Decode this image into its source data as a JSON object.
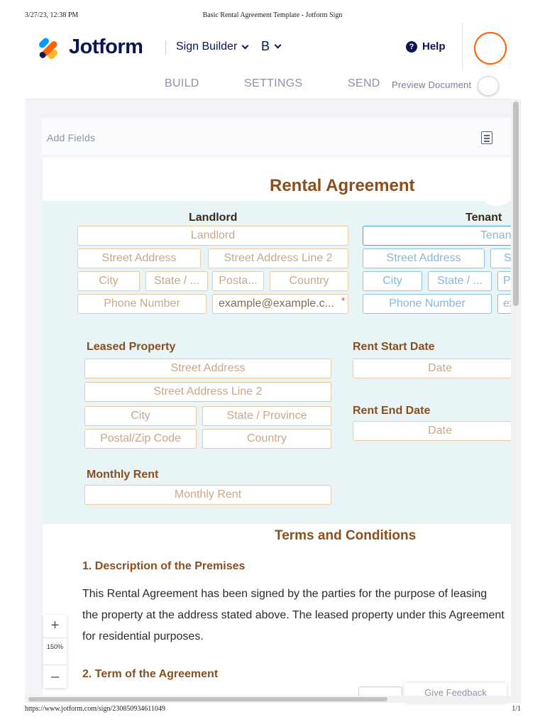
{
  "print": {
    "datetime": "3/27/23, 12:38 PM",
    "title": "Basic Rental Agreement Template - Jotform Sign",
    "url": "https://www.jotform.com/sign/230850934611049",
    "page": "1/1"
  },
  "header": {
    "logo_text": "Jotform",
    "sign_builder": "Sign Builder",
    "b_menu": "B",
    "help": "Help",
    "help_glyph": "?"
  },
  "tabs": {
    "build": "BUILD",
    "settings": "SETTINGS",
    "send": "SEND",
    "preview": "Preview Document"
  },
  "toolbar": {
    "add_fields": "Add Fields",
    "icon": "document-list-icon"
  },
  "document": {
    "title": "Rental Agreement",
    "landlord": {
      "heading": "Landlord",
      "name": "Landlord",
      "street": "Street Address",
      "street2": "Street Address Line 2",
      "city": "City",
      "state": "State / ...",
      "postal": "Posta...",
      "country": "Country",
      "phone": "Phone Number",
      "email": "example@example.c...",
      "required": "*"
    },
    "tenant": {
      "heading": "Tenant",
      "name": "Tenan",
      "street": "Street Address",
      "street2": "S",
      "city": "City",
      "state": "State / ...",
      "postal": "P",
      "phone": "Phone Number",
      "email": "ex"
    },
    "leased": {
      "heading": "Leased Property",
      "street": "Street Address",
      "street2": "Street Address Line 2",
      "city": "City",
      "state": "State / Province",
      "postal": "Postal/Zip Code",
      "country": "Country"
    },
    "rent_start": {
      "heading": "Rent Start Date",
      "placeholder": "Date"
    },
    "rent_end": {
      "heading": "Rent End Date",
      "placeholder": "Date"
    },
    "monthly_rent": {
      "heading": "Monthly Rent",
      "placeholder": "Monthly Rent"
    },
    "terms": {
      "title": "Terms and Conditions",
      "clause1_title": "1. Description of the Premises",
      "clause1_lines": [
        "This Rental Agreement has been signed by the parties for the purpose of leasing",
        "the property at the address stated above. The leased property under this Agreement",
        "for residential purposes."
      ],
      "clause2_title": "2. Term of the Agreement"
    }
  },
  "zoom": {
    "plus": "+",
    "value": "150%",
    "minus": "–"
  },
  "feedback": "Give Feedback",
  "colors": {
    "accent": "#8a4f1f",
    "brand_navy": "#0a1551",
    "brand_orange": "#ff6100",
    "teal_band": "#e8f4f5"
  }
}
